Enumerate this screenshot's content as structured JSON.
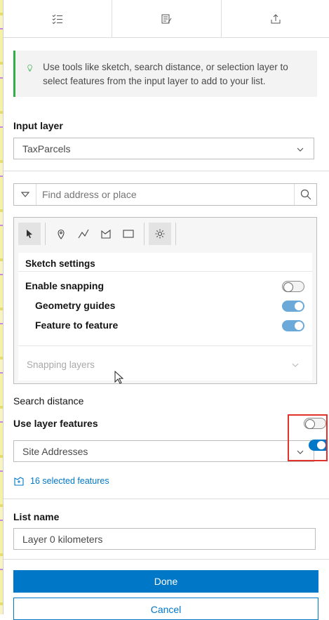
{
  "colors": {
    "accent": "#0077c7",
    "notice_bar": "#35ac46",
    "toggle_on": "#6aa9d8",
    "highlight": "#e2322b"
  },
  "tabs": [
    {
      "icon": "checklist-icon"
    },
    {
      "icon": "edit-list-icon"
    },
    {
      "icon": "export-icon"
    }
  ],
  "notice": {
    "icon": "lightbulb-icon",
    "text": "Use tools like sketch, search distance, or selection layer to select features from the input layer to add to your list."
  },
  "input_layer": {
    "label": "Input layer",
    "value": "TaxParcels"
  },
  "search": {
    "placeholder": "Find address or place"
  },
  "sketch": {
    "tools": [
      "select-icon",
      "point-icon",
      "polyline-icon",
      "polygon-icon",
      "rectangle-icon",
      "settings-icon"
    ],
    "settings_title": "Sketch settings",
    "enable_snapping": {
      "label": "Enable snapping",
      "on": false
    },
    "geometry_guides": {
      "label": "Geometry guides",
      "on": true
    },
    "feature_to_feature": {
      "label": "Feature to feature",
      "on": true
    },
    "snapping_layers": "Snapping layers"
  },
  "search_distance": {
    "label": "Search distance"
  },
  "use_layer_features": {
    "label": "Use layer features",
    "on": false
  },
  "layer_select": {
    "value": "Site Addresses"
  },
  "selected_features": "16 selected features",
  "list_name": {
    "label": "List name",
    "value": "Layer 0 kilometers"
  },
  "actions": {
    "done": "Done",
    "cancel": "Cancel"
  }
}
